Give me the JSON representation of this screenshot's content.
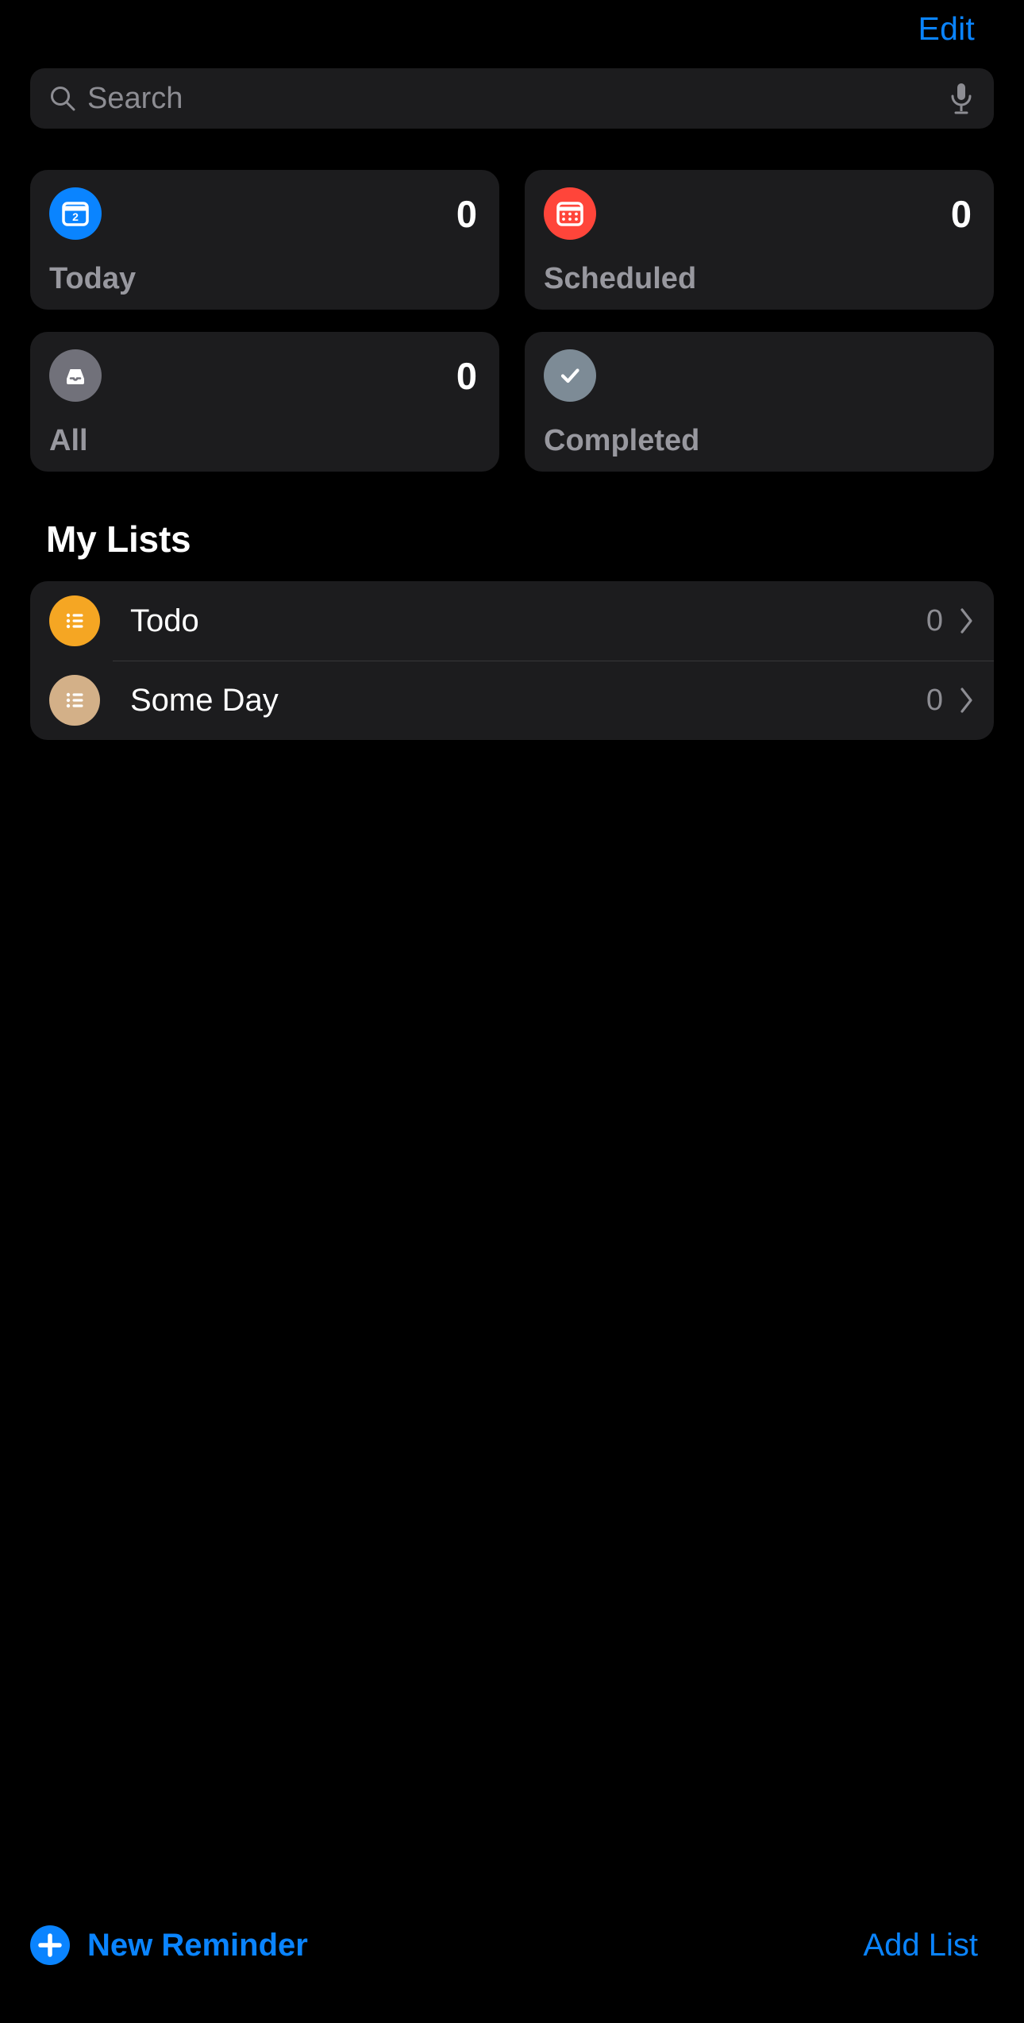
{
  "header": {
    "edit_label": "Edit"
  },
  "search": {
    "placeholder": "Search",
    "value": "",
    "search_icon": "search-icon",
    "mic_icon": "microphone-icon"
  },
  "smart_lists": [
    {
      "name": "Today",
      "count": "0",
      "icon": "calendar-day-icon",
      "icon_text": "2",
      "color": "#0a84ff",
      "has_count": true
    },
    {
      "name": "Scheduled",
      "count": "0",
      "icon": "calendar-grid-icon",
      "color": "#ff453a",
      "has_count": true
    },
    {
      "name": "All",
      "count": "0",
      "icon": "inbox-tray-icon",
      "color": "#71717a",
      "has_count": true
    },
    {
      "name": "Completed",
      "count": "",
      "icon": "checkmark-icon",
      "color": "#7d8b96",
      "has_count": false
    }
  ],
  "my_lists": {
    "title": "My Lists",
    "items": [
      {
        "name": "Todo",
        "count": "0",
        "icon": "bulleted-list-icon",
        "color": "#f5a623",
        "chevron": "chevron-right-icon"
      },
      {
        "name": "Some Day",
        "count": "0",
        "icon": "bulleted-list-icon",
        "color": "#d3b088",
        "chevron": "chevron-right-icon"
      }
    ]
  },
  "toolbar": {
    "new_reminder_label": "New Reminder",
    "new_reminder_icon": "plus-circle-icon",
    "add_list_label": "Add List"
  },
  "theme": {
    "accent": "#0a84ff",
    "background": "#000000",
    "card_background": "#1c1c1e",
    "secondary_text": "#98989f"
  }
}
